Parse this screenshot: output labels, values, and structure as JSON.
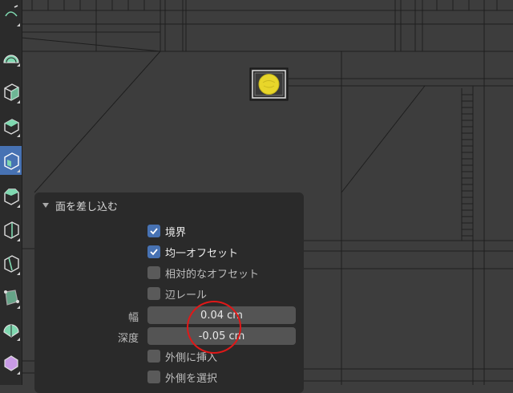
{
  "panel": {
    "title": "面を差し込む",
    "options": [
      {
        "label": "境界",
        "checked": true
      },
      {
        "label": "均一オフセット",
        "checked": true
      },
      {
        "label": "相対的なオフセット",
        "checked": false
      },
      {
        "label": "辺レール",
        "checked": false
      }
    ],
    "fields": [
      {
        "label": "幅",
        "value": "0.04 cm"
      },
      {
        "label": "深度",
        "value": "-0.05 cm"
      }
    ],
    "options_after": [
      {
        "label": "外側に挿入",
        "checked": false
      },
      {
        "label": "外側を選択",
        "checked": false
      }
    ]
  },
  "toolbar": {
    "tools": [
      {
        "icon": "annotate-icon",
        "active": false
      },
      {
        "icon": "measure-icon",
        "active": false
      },
      {
        "icon": "add-cube-icon",
        "active": false
      },
      {
        "icon": "extrude-region-icon",
        "active": false
      },
      {
        "icon": "inset-faces-icon",
        "active": true
      },
      {
        "icon": "bevel-icon",
        "active": false
      },
      {
        "icon": "loop-cut-icon",
        "active": false
      },
      {
        "icon": "knife-icon",
        "active": false
      },
      {
        "icon": "poly-build-icon",
        "active": false
      },
      {
        "icon": "spin-icon",
        "active": false
      },
      {
        "icon": "smooth-icon",
        "active": false
      }
    ]
  },
  "colors": {
    "accent": "#4772b3",
    "panel_bg": "#2a2a2a",
    "viewport_bg": "#3d3d3d",
    "annotation": "#e01818",
    "selected_face": "#e8d62a"
  }
}
